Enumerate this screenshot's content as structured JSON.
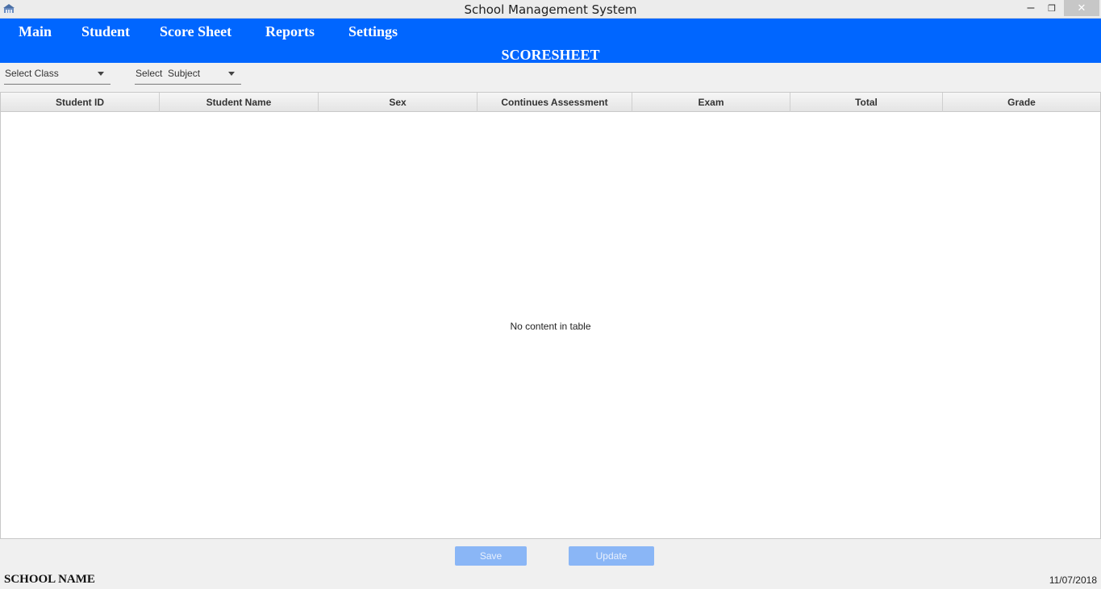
{
  "window": {
    "title": "School Management System",
    "minimize_glyph": "–",
    "maximize_glyph": "❐",
    "close_glyph": "✕"
  },
  "menu": {
    "items": [
      {
        "label": "Main"
      },
      {
        "label": "Student"
      },
      {
        "label": "Score Sheet"
      },
      {
        "label": "Reports"
      },
      {
        "label": "Settings"
      }
    ]
  },
  "page": {
    "section_title": "SCORESHEET"
  },
  "filters": {
    "class_combo": {
      "placeholder": "Select Class"
    },
    "subject_combo": {
      "placeholder": "Select  Subject"
    }
  },
  "table": {
    "columns": [
      {
        "label": "Student ID"
      },
      {
        "label": "Student Name"
      },
      {
        "label": "Sex"
      },
      {
        "label": "Continues Assessment"
      },
      {
        "label": "Exam"
      },
      {
        "label": "Total"
      },
      {
        "label": "Grade"
      }
    ],
    "rows": [],
    "empty_message": "No content in table"
  },
  "actions": {
    "save_label": "Save",
    "update_label": "Update"
  },
  "footer": {
    "school_name": "SCHOOL NAME",
    "date": "11/07/2018"
  },
  "colors": {
    "header_band": "#0066ff",
    "button_disabled": "#8ab6f6",
    "title_bar": "#ececec"
  },
  "icons": {
    "app": "school-building-icon",
    "minimize": "minimize-icon",
    "maximize": "restore-icon",
    "close": "close-icon",
    "dropdown": "chevron-down-icon"
  }
}
